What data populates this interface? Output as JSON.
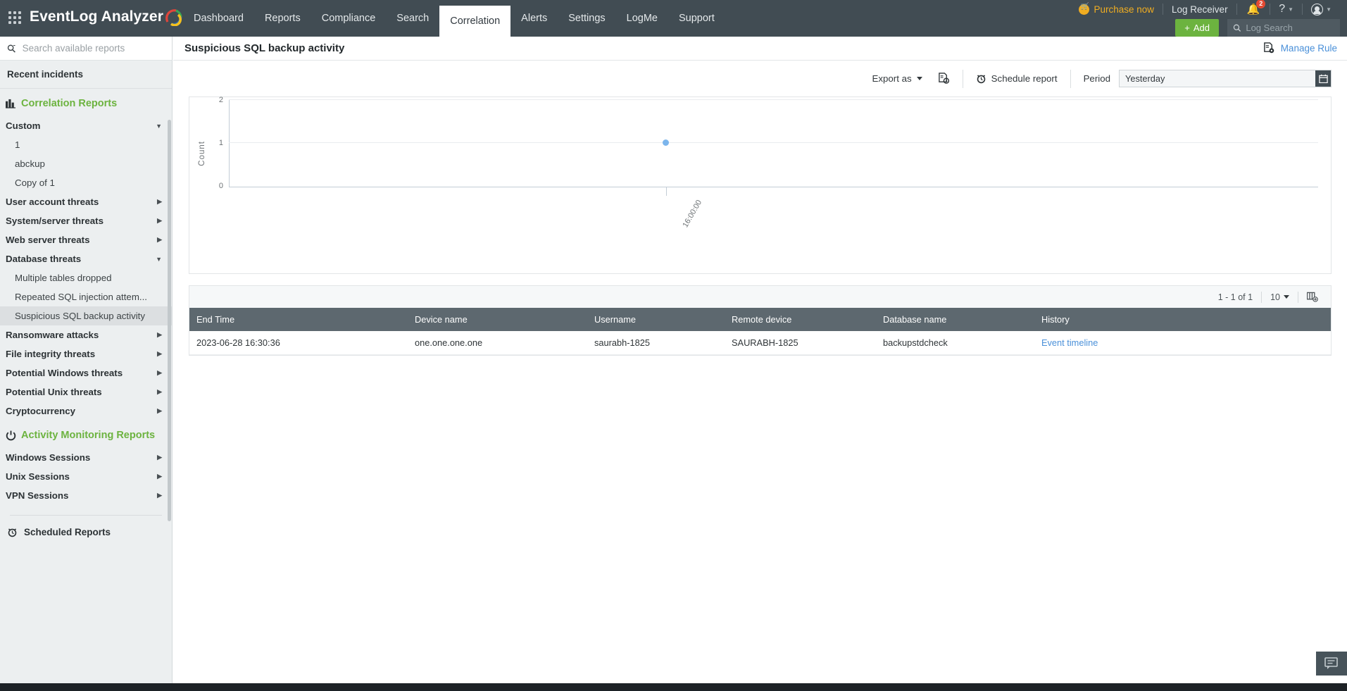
{
  "header": {
    "brand": "EventLog Analyzer",
    "waffle_icon": "grid-apps-icon",
    "nav": [
      {
        "label": "Dashboard",
        "active": false
      },
      {
        "label": "Reports",
        "active": false
      },
      {
        "label": "Compliance",
        "active": false
      },
      {
        "label": "Search",
        "active": false
      },
      {
        "label": "Correlation",
        "active": true
      },
      {
        "label": "Alerts",
        "active": false
      },
      {
        "label": "Settings",
        "active": false
      },
      {
        "label": "LogMe",
        "active": false
      },
      {
        "label": "Support",
        "active": false
      }
    ],
    "purchase_now": "Purchase now",
    "log_receiver": "Log Receiver",
    "notification_count": "2",
    "help": "?",
    "add_button": "Add",
    "log_search_placeholder": "Log Search"
  },
  "sidebar": {
    "search_placeholder": "Search available reports",
    "recent_incidents": "Recent incidents",
    "correlation_reports": "Correlation Reports",
    "activity_monitoring_reports": "Activity Monitoring Reports",
    "scheduled_reports": "Scheduled Reports",
    "items": [
      {
        "label": "Custom",
        "type": "group",
        "expanded": true,
        "selected": false
      },
      {
        "label": "1",
        "type": "child",
        "selected": false
      },
      {
        "label": "abckup",
        "type": "child",
        "selected": false
      },
      {
        "label": "Copy of 1",
        "type": "child",
        "selected": false
      },
      {
        "label": "User account threats",
        "type": "group",
        "expanded": false,
        "selected": false
      },
      {
        "label": "System/server threats",
        "type": "group",
        "expanded": false,
        "selected": false
      },
      {
        "label": "Web server threats",
        "type": "group",
        "expanded": false,
        "selected": false
      },
      {
        "label": "Database threats",
        "type": "group",
        "expanded": true,
        "selected": false
      },
      {
        "label": "Multiple tables dropped",
        "type": "child",
        "selected": false
      },
      {
        "label": "Repeated SQL injection attem...",
        "type": "child",
        "selected": false
      },
      {
        "label": "Suspicious SQL backup activity",
        "type": "child",
        "selected": true
      },
      {
        "label": "Ransomware attacks",
        "type": "group",
        "expanded": false,
        "selected": false
      },
      {
        "label": "File integrity threats",
        "type": "group",
        "expanded": false,
        "selected": false
      },
      {
        "label": "Potential Windows threats",
        "type": "group",
        "expanded": false,
        "selected": false
      },
      {
        "label": "Potential Unix threats",
        "type": "group",
        "expanded": false,
        "selected": false
      },
      {
        "label": "Cryptocurrency",
        "type": "group",
        "expanded": false,
        "selected": false
      }
    ],
    "activity_items": [
      {
        "label": "Windows Sessions",
        "type": "group",
        "expanded": false,
        "selected": false
      },
      {
        "label": "Unix Sessions",
        "type": "group",
        "expanded": false,
        "selected": false
      },
      {
        "label": "VPN Sessions",
        "type": "group",
        "expanded": false,
        "selected": false
      }
    ]
  },
  "page": {
    "title": "Suspicious SQL backup activity",
    "manage_rule": "Manage Rule"
  },
  "toolbar": {
    "export_as": "Export as",
    "schedule_report": "Schedule report",
    "period_label": "Period",
    "period_value": "Yesterday"
  },
  "chart_data": {
    "type": "scatter",
    "title": "",
    "xlabel": "",
    "ylabel": "Count",
    "x_tick_labels": [
      "16:00:00"
    ],
    "categories": [
      "16:00:00"
    ],
    "values": [
      1
    ],
    "points": [
      {
        "x": "16:00:00",
        "y": 1
      }
    ],
    "ylim": [
      0,
      2
    ],
    "y_ticks": [
      "0",
      "1",
      "2"
    ],
    "grid": true,
    "legend": "none",
    "point_color": "#7cb5ec"
  },
  "table": {
    "pagination": "1 - 1 of 1",
    "page_size": "10",
    "columns_icon": "column-settings-icon",
    "columns": [
      "End Time",
      "Device name",
      "Username",
      "Remote device",
      "Database name",
      "History"
    ],
    "rows": [
      {
        "end_time": "2023-06-28 16:30:36",
        "device_name": "one.one.one.one",
        "username": "saurabh-1825",
        "remote_device": "SAURABH-1825",
        "database_name": "backupstdcheck",
        "history": "Event timeline"
      }
    ]
  }
}
